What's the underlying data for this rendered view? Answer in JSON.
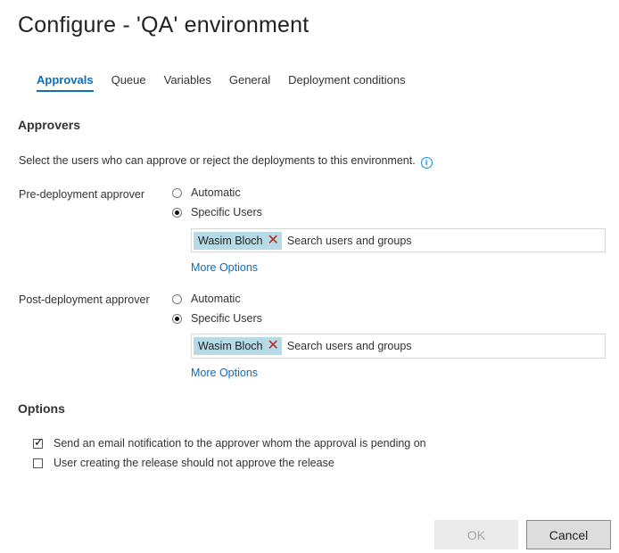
{
  "dialog": {
    "title": "Configure - 'QA' environment"
  },
  "tabs": [
    {
      "label": "Approvals",
      "active": true
    },
    {
      "label": "Queue"
    },
    {
      "label": "Variables"
    },
    {
      "label": "General"
    },
    {
      "label": "Deployment conditions"
    }
  ],
  "approvers": {
    "heading": "Approvers",
    "description": "Select the users who can approve or reject the deployments to this environment.",
    "pre": {
      "label": "Pre-deployment approver",
      "option_automatic": "Automatic",
      "option_specific": "Specific Users",
      "selected": "Specific Users",
      "chip": "Wasim Bloch",
      "search_placeholder": "Search users and groups",
      "more_options": "More Options"
    },
    "post": {
      "label": "Post-deployment approver",
      "option_automatic": "Automatic",
      "option_specific": "Specific Users",
      "selected": "Specific Users",
      "chip": "Wasim Bloch",
      "search_placeholder": "Search users and groups",
      "more_options": "More Options"
    }
  },
  "options": {
    "heading": "Options",
    "email_notification": {
      "label": "Send an email notification to the approver whom the approval is pending on",
      "checked": true
    },
    "creator_not_approve": {
      "label": "User creating the release should not approve the release",
      "checked": false
    }
  },
  "buttons": {
    "ok": "OK",
    "cancel": "Cancel"
  },
  "colors": {
    "accent": "#0a6ebd",
    "chip_bg": "#b4dbe6",
    "chip_remove": "#c8201f"
  }
}
